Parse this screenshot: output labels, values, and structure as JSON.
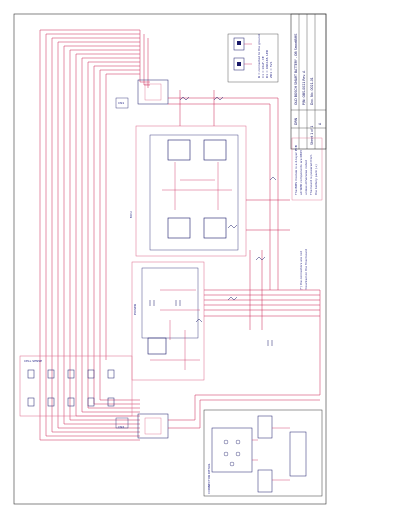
{
  "title_block": {
    "title": "OLD BOSCH SMART BATTERY - OB SmartBMS",
    "part_number": "P/N: OBS-0021 Rev. A",
    "doc_number": "Doc. No. 0021-01",
    "sheet": "Sheet 1 of 1",
    "drawn": "DRN",
    "rev_label": "A"
  },
  "notes": {
    "top_right": [
      "R = connected to the ground",
      "C1 = 10uF, CE",
      "D1 = 1N4148, LED",
      "ZD1 = 5V1"
    ],
    "mid_right": [
      "The BMS module is a 2-layer PCB",
      "all SMD components are 0805",
      "unless otherwise noted",
      "The board is powered from",
      "the battery pack (+)"
    ],
    "lower_right": [
      "(*) the connectors are not",
      "mounted on the final board"
    ]
  },
  "labels": {
    "connector_top": "CN1",
    "connector_bottom": "CN2",
    "block_mcu": "MCU",
    "block_power": "POWER",
    "block_left": "CELL SENSE",
    "block_connector": "CONNECTOR DETAIL"
  },
  "colors": {
    "wire": "#cc2255",
    "frame": "#333333",
    "component": "#1a1a6a",
    "block": "#dd6688"
  }
}
